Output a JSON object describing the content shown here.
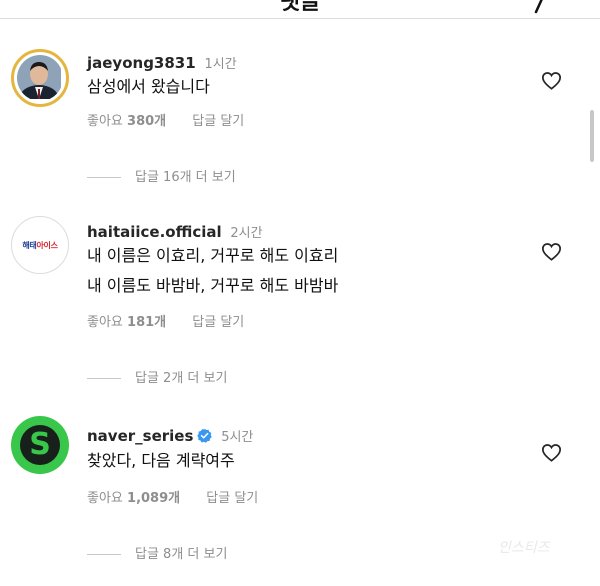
{
  "header": {
    "title": "댓글"
  },
  "comments": [
    {
      "username": "jaeyong3831",
      "time": "1시간",
      "lines": [
        "삼성에서 왔습니다"
      ],
      "likes_label": "좋아요",
      "likes_count": "380개",
      "reply_label": "답글 달기",
      "view_replies": "답글 16개 더 보기",
      "avatar": "person-photo"
    },
    {
      "username": "haitaiice.official",
      "time": "2시간",
      "lines": [
        "내 이름은 이효리, 거꾸로 해도 이효리",
        "내 이름도 바밤바, 거꾸로 해도 바밤바"
      ],
      "likes_label": "좋아요",
      "likes_count": "181개",
      "reply_label": "답글 달기",
      "view_replies": "답글 2개 더 보기",
      "avatar_logo": "해태아이스"
    },
    {
      "username": "naver_series",
      "time": "5시간",
      "lines": [
        "찾았다, 다음 계략여주"
      ],
      "likes_label": "좋아요",
      "likes_count": "1,089개",
      "reply_label": "답글 달기",
      "view_replies": "답글 8개 더 보기",
      "avatar_letter": "S",
      "verified": true
    }
  ],
  "colors": {
    "verified_blue": "#3897f0",
    "ring_gold": "#e4b640",
    "naver_green": "#38c74a"
  },
  "watermark": "인스티즈"
}
